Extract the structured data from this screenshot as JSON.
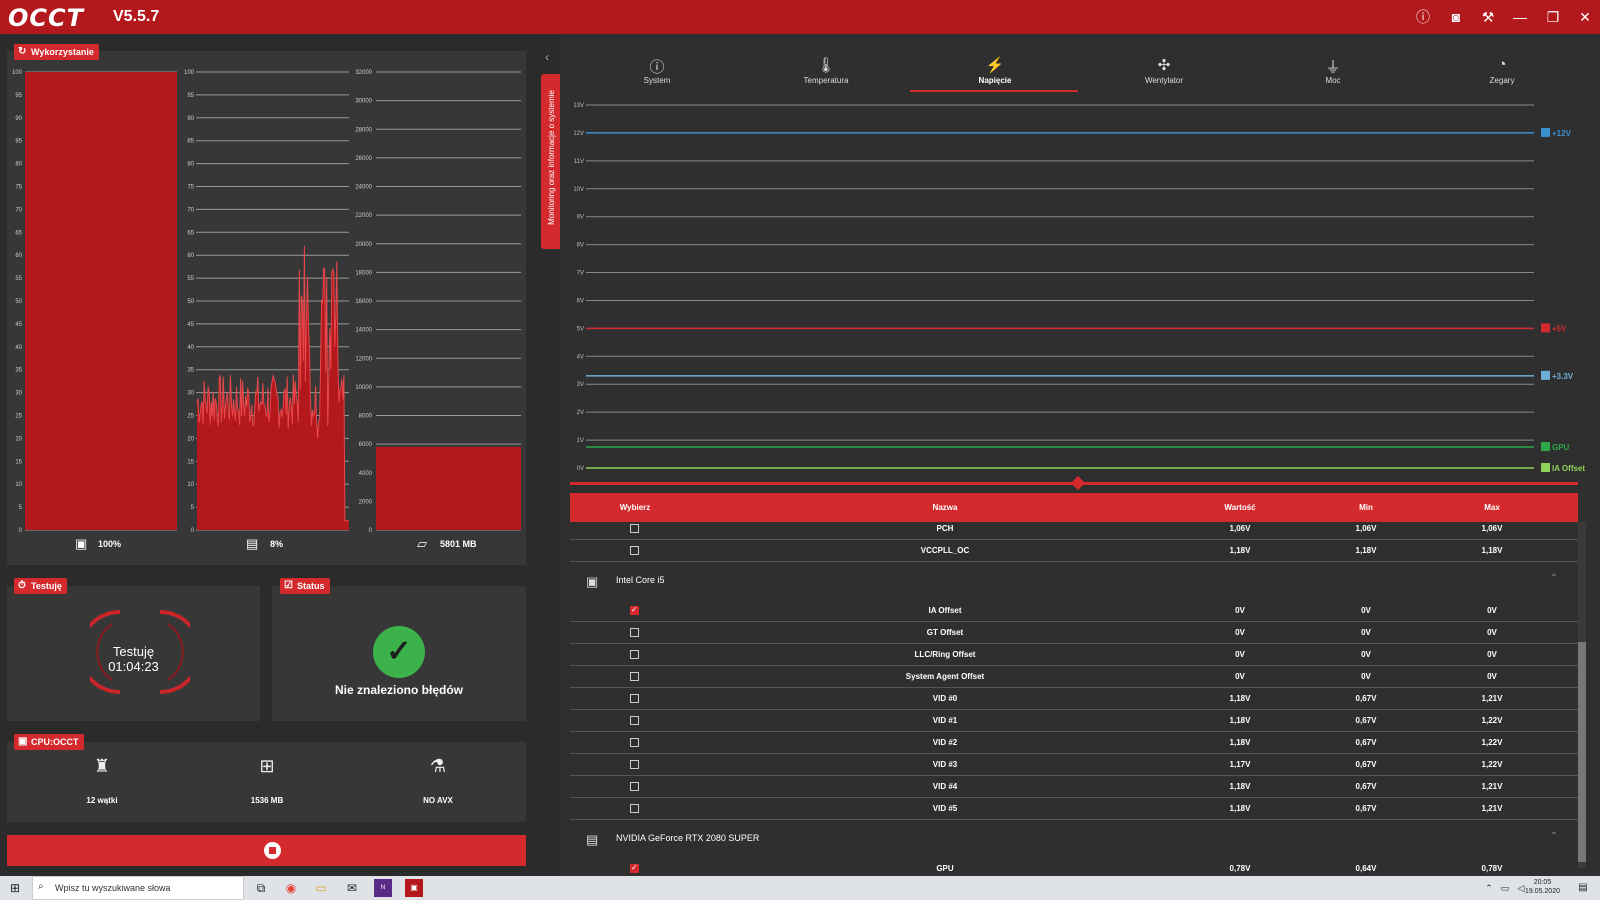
{
  "app": {
    "name": "OCCT",
    "version": "V5.5.7"
  },
  "titlebar": {
    "icons": [
      "info-icon",
      "camera-icon",
      "wrench-icon",
      "minimize-icon",
      "restore-icon",
      "close-icon"
    ]
  },
  "usage": {
    "badge": "Wykorzystanie",
    "cpu_value": "100%",
    "gpu_value": "8%",
    "ram_value": "5801 MB",
    "cpu_ticks": [
      "100",
      "95",
      "90",
      "85",
      "80",
      "75",
      "70",
      "65",
      "60",
      "55",
      "50",
      "45",
      "40",
      "35",
      "30",
      "25",
      "20",
      "15",
      "10",
      "5",
      "0"
    ],
    "gpu_ticks": [
      "100",
      "95",
      "90",
      "85",
      "80",
      "75",
      "70",
      "65",
      "60",
      "55",
      "50",
      "45",
      "40",
      "35",
      "30",
      "25",
      "20",
      "15",
      "10",
      "5",
      "0"
    ],
    "ram_ticks": [
      "32000",
      "30000",
      "28000",
      "26000",
      "24000",
      "22000",
      "20000",
      "18000",
      "16000",
      "14000",
      "12000",
      "10000",
      "8000",
      "6000",
      "4000",
      "2000",
      "0"
    ],
    "cpu_level_pct": 100,
    "ram_level_mb": 5801,
    "colors": {
      "bar": "#b3181c",
      "line": "#e8474b"
    }
  },
  "test": {
    "badge": "Testuję",
    "label": "Testuję",
    "time": "01:04:23"
  },
  "status": {
    "badge": "Status",
    "message": "Nie znaleziono błędów",
    "color": "#3cb34a"
  },
  "cpu_test": {
    "badge": "CPU:OCCT",
    "threads": "12 wątki",
    "memory": "1536 MB",
    "mode": "NO AVX"
  },
  "side_tab": {
    "label": "Monitoring oraz informacje o systemie"
  },
  "tabs": [
    {
      "label": "System",
      "icon": "info-icon"
    },
    {
      "label": "Temperatura",
      "icon": "thermometer-icon"
    },
    {
      "label": "Napięcie",
      "icon": "voltage-icon",
      "active": true
    },
    {
      "label": "Wentylator",
      "icon": "fan-icon"
    },
    {
      "label": "Moc",
      "icon": "plug-icon"
    },
    {
      "label": "Zegary",
      "icon": "gauge-icon"
    }
  ],
  "chart_data": {
    "type": "line",
    "y_ticks": [
      "13V",
      "12V",
      "11V",
      "10V",
      "9V",
      "8V",
      "7V",
      "6V",
      "5V",
      "4V",
      "3V",
      "2V",
      "1V",
      "0V"
    ],
    "ylim": [
      0,
      13
    ],
    "series": [
      {
        "name": "+12V",
        "value": 12.0,
        "color": "#3a8fd0"
      },
      {
        "name": "+5V",
        "value": 5.0,
        "color": "#d42a2e"
      },
      {
        "name": "+3.3V",
        "value": 3.3,
        "color": "#6fb1d6"
      },
      {
        "name": "GPU",
        "value": 0.75,
        "color": "#2fa84a"
      },
      {
        "name": "IA Offset",
        "value": 0.0,
        "color": "#8fd35a"
      }
    ]
  },
  "table": {
    "headers": {
      "select": "Wybierz",
      "name": "Nazwa",
      "value": "Wartość",
      "min": "Min",
      "max": "Max"
    },
    "top_rows": [
      {
        "name": "PCH",
        "value": "1,06V",
        "min": "1,06V",
        "max": "1,06V",
        "checked": false
      },
      {
        "name": "VCCPLL_OC",
        "value": "1,18V",
        "min": "1,18V",
        "max": "1,18V",
        "checked": false
      }
    ],
    "group1": {
      "name": "Intel Core i5"
    },
    "group1_rows": [
      {
        "name": "IA Offset",
        "value": "0V",
        "min": "0V",
        "max": "0V",
        "checked": true
      },
      {
        "name": "GT Offset",
        "value": "0V",
        "min": "0V",
        "max": "0V",
        "checked": false
      },
      {
        "name": "LLC/Ring Offset",
        "value": "0V",
        "min": "0V",
        "max": "0V",
        "checked": false
      },
      {
        "name": "System Agent Offset",
        "value": "0V",
        "min": "0V",
        "max": "0V",
        "checked": false
      },
      {
        "name": "VID #0",
        "value": "1,18V",
        "min": "0,67V",
        "max": "1,21V",
        "checked": false
      },
      {
        "name": "VID #1",
        "value": "1,18V",
        "min": "0,67V",
        "max": "1,22V",
        "checked": false
      },
      {
        "name": "VID #2",
        "value": "1,18V",
        "min": "0,67V",
        "max": "1,22V",
        "checked": false
      },
      {
        "name": "VID #3",
        "value": "1,17V",
        "min": "0,67V",
        "max": "1,22V",
        "checked": false
      },
      {
        "name": "VID #4",
        "value": "1,18V",
        "min": "0,67V",
        "max": "1,21V",
        "checked": false
      },
      {
        "name": "VID #5",
        "value": "1,18V",
        "min": "0,67V",
        "max": "1,21V",
        "checked": false
      }
    ],
    "group2": {
      "name": "NVIDIA GeForce RTX 2080 SUPER"
    },
    "group2_rows": [
      {
        "name": "GPU",
        "value": "0,78V",
        "min": "0,64V",
        "max": "0,78V",
        "checked": true
      }
    ]
  },
  "taskbar": {
    "search_placeholder": "Wpisz tu wyszukiwane słowa",
    "time": "20:05",
    "date": "19.05.2020"
  }
}
